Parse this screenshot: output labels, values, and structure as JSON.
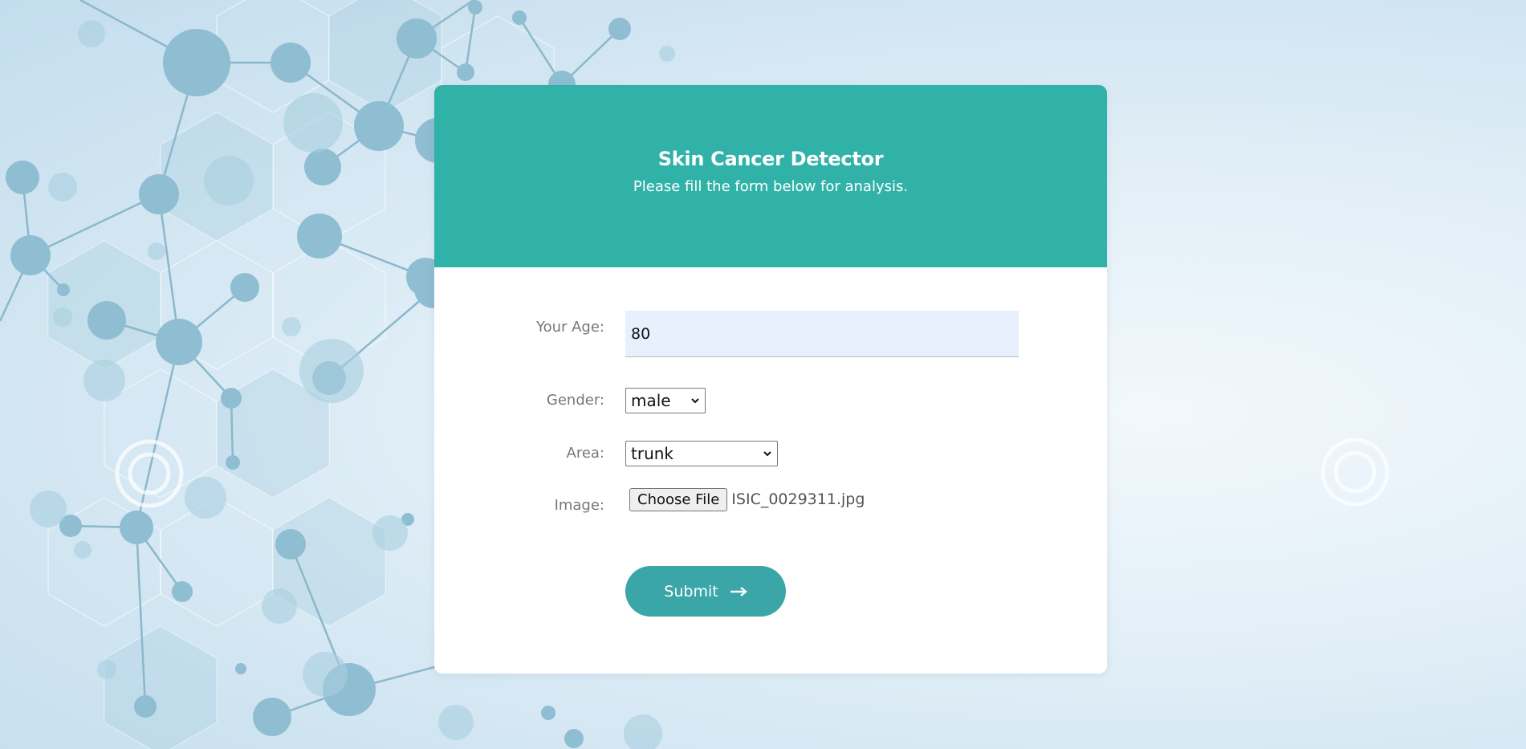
{
  "header": {
    "title": "Skin Cancer Detector",
    "subtitle": "Please fill the form below for analysis."
  },
  "form": {
    "age": {
      "label": "Your Age:",
      "value": "80"
    },
    "gender": {
      "label": "Gender:",
      "selected": "male"
    },
    "area": {
      "label": "Area:",
      "selected": "trunk"
    },
    "image": {
      "label": "Image:",
      "button_label": "Choose File",
      "file_name": "ISIC_0029311.jpg"
    },
    "submit_label": "Submit"
  },
  "icons": {
    "submit": "arrow-right-icon",
    "select": "chevron-down-icon"
  },
  "colors": {
    "header": "#31b2a8",
    "submit": "#3aa6a8",
    "input_background": "#e8f0fe"
  }
}
